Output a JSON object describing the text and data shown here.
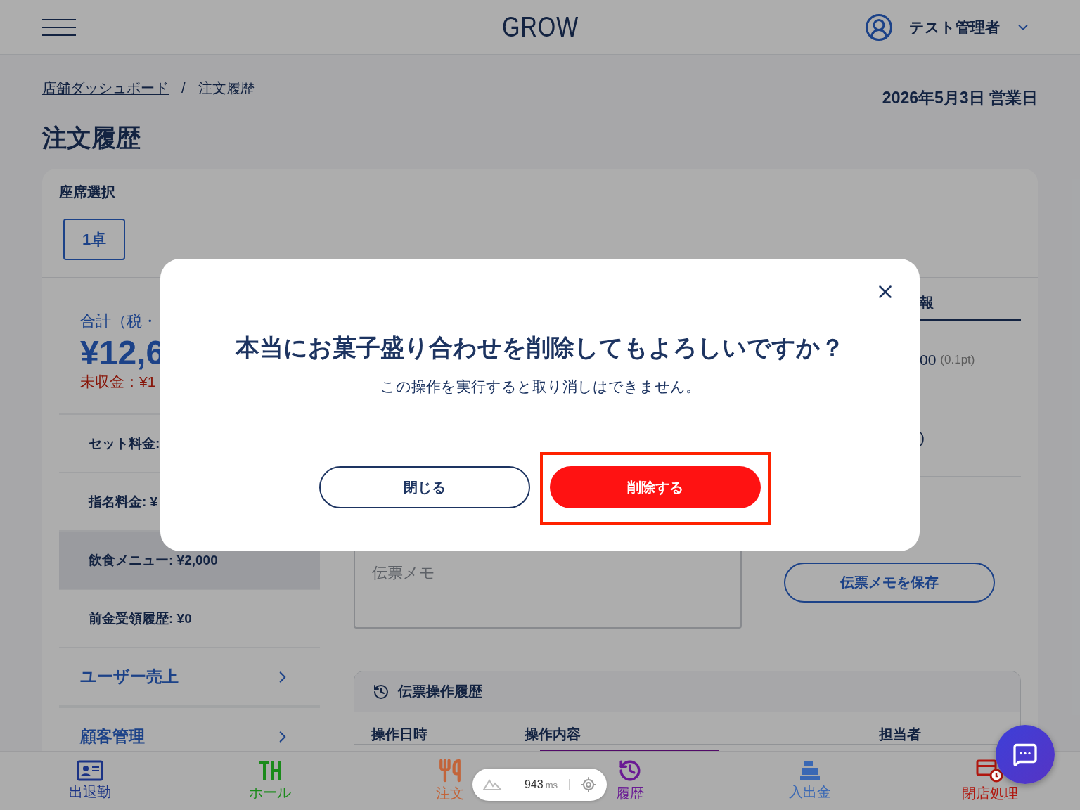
{
  "header": {
    "logo": "GROW",
    "user": "テスト管理者"
  },
  "breadcrumb": [
    {
      "label": "店舗ダッシュボード",
      "kind": "link"
    },
    {
      "label": "注文履歴",
      "kind": "current"
    }
  ],
  "breadcrumb_separator": "/",
  "business_date": "2026年5月3日 営業日",
  "page_title": "注文履歴",
  "seat_select": {
    "label": "座席選択",
    "seats": [
      {
        "label": "1卓",
        "selected": true
      }
    ]
  },
  "summary": {
    "total_label": "合計（税・",
    "total": "¥12,6",
    "unpaid": "未収金：¥1"
  },
  "fees": [
    {
      "label": "セット料金:",
      "highlighted": false
    },
    {
      "label": "指名料金: ¥",
      "highlighted": false
    },
    {
      "label": "飲食メニュー: ¥2,000",
      "highlighted": true
    },
    {
      "label": "前金受領履歴: ¥0",
      "highlighted": false
    }
  ],
  "links": [
    {
      "label": "ユーザー売上"
    },
    {
      "label": "顧客管理"
    }
  ],
  "info_tab": {
    "label": "報",
    "selected": true
  },
  "info_rows": [
    {
      "value": "00",
      "note": "(0.1pt)"
    },
    {
      "value": ")"
    }
  ],
  "memo": {
    "placeholder": "伝票メモ",
    "save_button": "伝票メモを保存"
  },
  "history": {
    "title": "伝票操作履歴",
    "columns": [
      "操作日時",
      "操作内容",
      "担当者"
    ]
  },
  "nav": [
    {
      "label": "出退勤",
      "kind": "attendance",
      "color": "#1b3385"
    },
    {
      "label": "ホール",
      "kind": "hall",
      "color": "#1a8a1a"
    },
    {
      "label": "注文",
      "kind": "order",
      "color": "#c2643a"
    },
    {
      "label": "履歴",
      "kind": "history",
      "color": "#6a1a94"
    },
    {
      "label": "入出金",
      "kind": "cash",
      "color": "#3a68b4"
    },
    {
      "label": "閉店処理",
      "kind": "closing",
      "color": "#b0170f"
    }
  ],
  "dev_badge": {
    "time": "943",
    "unit": "ms"
  },
  "dialog": {
    "title": "本当にお菓子盛り合わせを削除してもよろしいですか？",
    "message": "この操作を実行すると取り消しはできません。",
    "buttons": [
      {
        "label": "閉じる",
        "kind": "secondary",
        "highlighted": false
      },
      {
        "label": "削除する",
        "kind": "danger",
        "highlighted": true
      }
    ]
  }
}
